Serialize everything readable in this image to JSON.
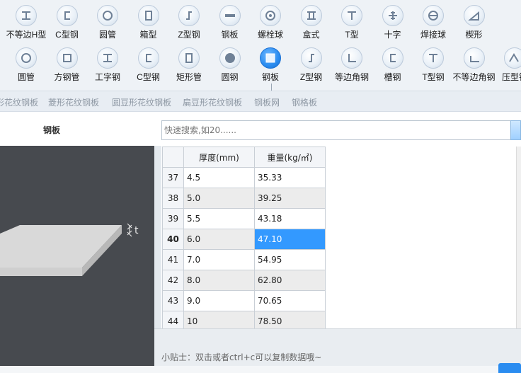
{
  "palette": {
    "row1": [
      {
        "label": "不等边H型",
        "icon": "h-beam-icon"
      },
      {
        "label": "C型钢",
        "icon": "c-channel-icon"
      },
      {
        "label": "圆管",
        "icon": "round-tube-icon"
      },
      {
        "label": "箱型",
        "icon": "box-section-icon"
      },
      {
        "label": "Z型钢",
        "icon": "z-section-icon"
      },
      {
        "label": "钢板",
        "icon": "steel-plate-icon"
      },
      {
        "label": "螺栓球",
        "icon": "bolt-ball-icon"
      },
      {
        "label": "盒式",
        "icon": "box-type-icon"
      },
      {
        "label": "T型",
        "icon": "t-section-icon"
      },
      {
        "label": "十字",
        "icon": "cross-section-icon"
      },
      {
        "label": "焊接球",
        "icon": "welded-ball-icon"
      },
      {
        "label": "楔形",
        "icon": "wedge-icon"
      }
    ],
    "row2": [
      {
        "label": "圆管",
        "icon": "round-tube-icon"
      },
      {
        "label": "方钢管",
        "icon": "square-tube-icon"
      },
      {
        "label": "工字钢",
        "icon": "i-beam-icon"
      },
      {
        "label": "C型钢",
        "icon": "c-channel-icon"
      },
      {
        "label": "矩形管",
        "icon": "rect-tube-icon"
      },
      {
        "label": "圆钢",
        "icon": "round-bar-icon"
      },
      {
        "label": "钢板",
        "icon": "steel-plate-icon",
        "active": true
      },
      {
        "label": "Z型钢",
        "icon": "z-section-icon"
      },
      {
        "label": "等边角钢",
        "icon": "equal-angle-icon"
      },
      {
        "label": "槽钢",
        "icon": "channel-icon"
      },
      {
        "label": "T型钢",
        "icon": "t-section-icon"
      },
      {
        "label": "不等边角钢",
        "icon": "unequal-angle-icon"
      },
      {
        "label": "压型钢",
        "icon": "profiled-steel-icon"
      }
    ]
  },
  "subtabs": [
    "形花纹钢板",
    "菱形花纹钢板",
    "圆豆形花纹钢板",
    "扁豆形花纹钢板",
    "钢板网",
    "钢格板"
  ],
  "left": {
    "title": "钢板",
    "dimension_label": "t"
  },
  "search": {
    "placeholder": "快速搜索,如20......"
  },
  "table": {
    "headers": [
      "厚度(mm)",
      "重量(kg/㎡)"
    ],
    "rows": [
      {
        "n": "37",
        "thickness": "4.5",
        "weight": "35.33"
      },
      {
        "n": "38",
        "thickness": "5.0",
        "weight": "39.25"
      },
      {
        "n": "39",
        "thickness": "5.5",
        "weight": "43.18"
      },
      {
        "n": "40",
        "thickness": "6.0",
        "weight": "47.10",
        "selected": true
      },
      {
        "n": "41",
        "thickness": "7.0",
        "weight": "54.95"
      },
      {
        "n": "42",
        "thickness": "8.0",
        "weight": "62.80"
      },
      {
        "n": "43",
        "thickness": "9.0",
        "weight": "70.65"
      },
      {
        "n": "44",
        "thickness": "10",
        "weight": "78.50"
      }
    ]
  },
  "tip": "小贴士：双击或者ctrl+c可以复制数据哦~",
  "colors": {
    "accent": "#3399ff",
    "preview_bg": "#474a4f"
  }
}
